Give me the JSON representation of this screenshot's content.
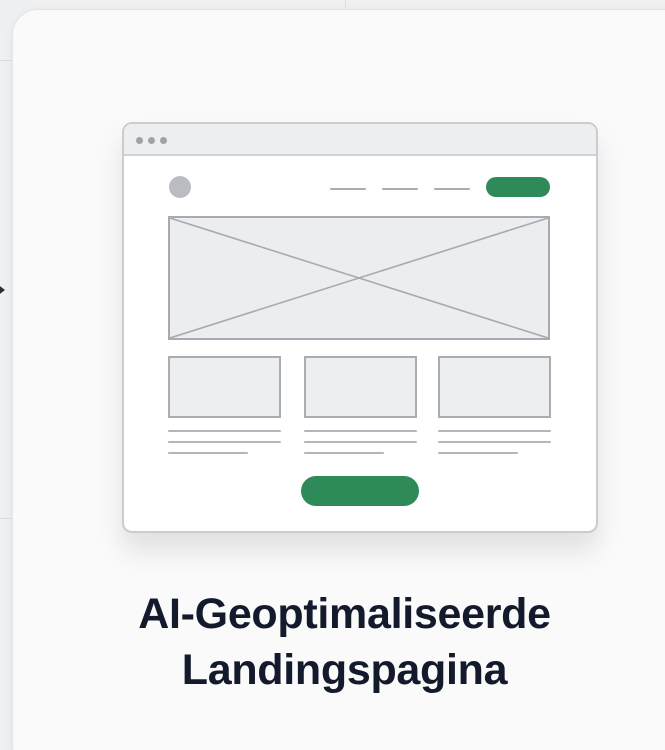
{
  "card": {
    "title_line1": "AI-Geoptimaliseerde",
    "title_line2": "Landingspagina",
    "illustration": "landing-page-wireframe",
    "accent_color": "#2f8a5a"
  },
  "icons": {
    "edge_arrow": "chevron-right-icon"
  }
}
